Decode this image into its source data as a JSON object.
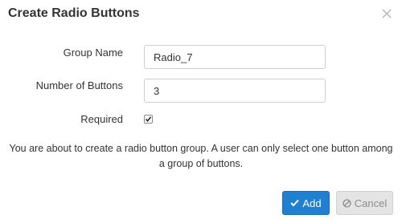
{
  "dialog": {
    "title": "Create Radio Buttons",
    "close_icon": "close-icon"
  },
  "form": {
    "group_name": {
      "label": "Group Name",
      "value": "Radio_7"
    },
    "number_of_buttons": {
      "label": "Number of Buttons",
      "value": "3"
    },
    "required": {
      "label": "Required",
      "checked": true
    }
  },
  "info": "You are about to create a radio button group. A user can only select one button among a group of buttons.",
  "buttons": {
    "add": {
      "label": "Add",
      "icon": "checkmark-icon",
      "color": "#1f7fd0"
    },
    "cancel": {
      "label": "Cancel",
      "icon": "ban-icon",
      "color": "#e4e4e4"
    }
  }
}
